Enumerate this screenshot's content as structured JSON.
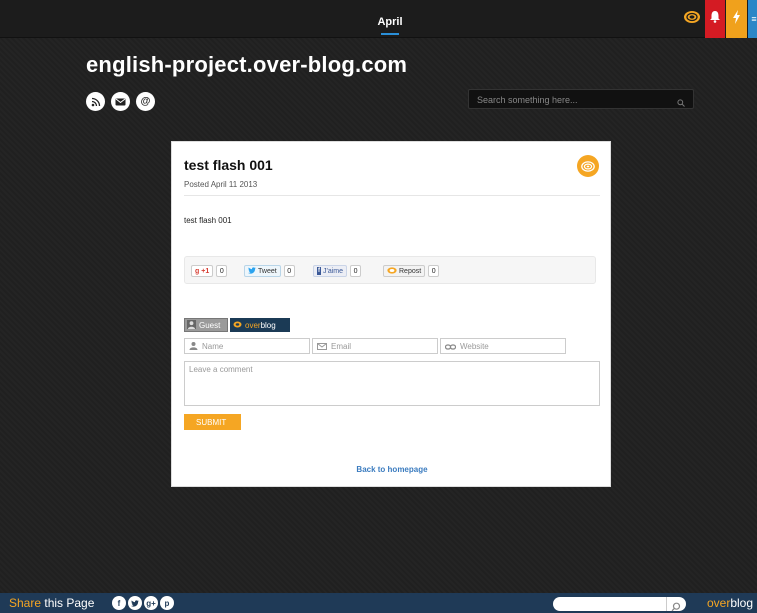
{
  "topbar": {
    "menu_item": "April"
  },
  "blog": {
    "title": "english-project.over-blog.com"
  },
  "search": {
    "placeholder": "Search something here..."
  },
  "post": {
    "title": "test flash 001",
    "date": "Posted April 11 2013",
    "body": "test flash 001"
  },
  "share": {
    "gplus_label": "+1",
    "gplus_count": "0",
    "tweet_label": "Tweet",
    "tweet_count": "0",
    "fb_label": "J'aime",
    "fb_count": "0",
    "repost_label": "Repost",
    "repost_count": "0"
  },
  "comment_form": {
    "tab_guest": "Guest",
    "tab_overblog_prefix": "over",
    "tab_overblog_suffix": "blog",
    "name_placeholder": "Name",
    "email_placeholder": "Email",
    "website_placeholder": "Website",
    "comment_placeholder": "Leave a comment",
    "submit_label": "SUBMIT"
  },
  "back_link": "Back to homepage",
  "footer": {
    "share_highlight": "Share",
    "share_rest": " this Page",
    "brand_prefix": "over",
    "brand_suffix": "blog"
  },
  "colors": {
    "accent": "#f5a623",
    "link": "#3a7bbf",
    "footer_bg": "#1f3a57"
  }
}
